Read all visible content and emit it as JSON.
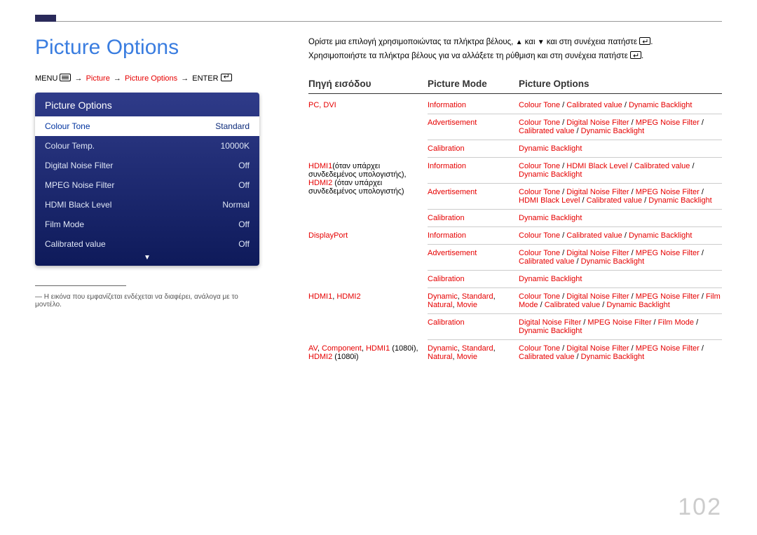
{
  "page_title": "Picture Options",
  "menupath": {
    "menu": "MENU",
    "picture": "Picture",
    "picture_options": "Picture Options",
    "enter": "ENTER"
  },
  "panel": {
    "title": "Picture Options",
    "rows": [
      {
        "label": "Colour Tone",
        "value": "Standard",
        "selected": true
      },
      {
        "label": "Colour Temp.",
        "value": "10000K"
      },
      {
        "label": "Digital Noise Filter",
        "value": "Off"
      },
      {
        "label": "MPEG Noise Filter",
        "value": "Off"
      },
      {
        "label": "HDMI Black Level",
        "value": "Normal"
      },
      {
        "label": "Film Mode",
        "value": "Off"
      },
      {
        "label": "Calibrated value",
        "value": "Off"
      }
    ]
  },
  "footnote_dash": "―",
  "footnote": "Η εικόνα που εμφανίζεται ενδέχεται να διαφέρει, ανάλογα με το μοντέλο.",
  "intro1_a": "Ορίστε μια επιλογή χρησιμοποιώντας τα πλήκτρα βέλους, ",
  "intro1_b": " και ",
  "intro1_c": " και στη συνέχεια πατήστε ",
  "intro1_d": ".",
  "intro2_a": "Χρησιμοποιήστε τα πλήκτρα βέλους για να αλλάξετε τη ρύθμιση και στη συνέχεια πατήστε ",
  "intro2_b": ".",
  "tri_up": "▲",
  "tri_down": "▼",
  "thead": {
    "c1": "Πηγή εισόδου",
    "c2": "Picture Mode",
    "c3": "Picture Options"
  },
  "blocks": [
    {
      "src": [
        {
          "t": "PC, DVI",
          "red": true
        }
      ],
      "subs": [
        {
          "mode": [
            {
              "t": "Information",
              "red": true
            }
          ],
          "opts": [
            {
              "t": "Colour Tone",
              "red": true
            },
            {
              "t": " / "
            },
            {
              "t": "Calibrated value",
              "red": true
            },
            {
              "t": " / "
            },
            {
              "t": "Dynamic Backlight",
              "red": true
            }
          ]
        },
        {
          "mode": [
            {
              "t": "Advertisement",
              "red": true
            }
          ],
          "opts": [
            {
              "t": "Colour Tone",
              "red": true
            },
            {
              "t": " / "
            },
            {
              "t": "Digital Noise Filter",
              "red": true
            },
            {
              "t": " / "
            },
            {
              "t": "MPEG Noise Filter",
              "red": true
            },
            {
              "t": " / "
            },
            {
              "t": "Calibrated value",
              "red": true
            },
            {
              "t": " / "
            },
            {
              "t": "Dynamic Backlight",
              "red": true
            }
          ]
        },
        {
          "mode": [
            {
              "t": "Calibration",
              "red": true
            }
          ],
          "opts": [
            {
              "t": "Dynamic Backlight",
              "red": true
            }
          ]
        }
      ]
    },
    {
      "src": [
        {
          "t": "HDMI1",
          "red": true
        },
        {
          "t": "(όταν υπάρχει συνδεδεμένος υπολογιστής), "
        },
        {
          "t": "HDMI2",
          "red": true
        },
        {
          "t": " (όταν υπάρχει συνδεδεμένος υπολογιστής)"
        }
      ],
      "subs": [
        {
          "mode": [
            {
              "t": "Information",
              "red": true
            }
          ],
          "opts": [
            {
              "t": "Colour Tone",
              "red": true
            },
            {
              "t": " / "
            },
            {
              "t": "HDMI Black Level",
              "red": true
            },
            {
              "t": " / "
            },
            {
              "t": "Calibrated value",
              "red": true
            },
            {
              "t": " / "
            },
            {
              "t": "Dynamic Backlight",
              "red": true
            }
          ]
        },
        {
          "mode": [
            {
              "t": "Advertisement",
              "red": true
            }
          ],
          "opts": [
            {
              "t": "Colour Tone",
              "red": true
            },
            {
              "t": " / "
            },
            {
              "t": "Digital Noise Filter",
              "red": true
            },
            {
              "t": " / "
            },
            {
              "t": "MPEG Noise Filter",
              "red": true
            },
            {
              "t": " / "
            },
            {
              "t": "HDMI Black Level",
              "red": true
            },
            {
              "t": " / "
            },
            {
              "t": "Calibrated value",
              "red": true
            },
            {
              "t": " / "
            },
            {
              "t": "Dynamic Backlight",
              "red": true
            }
          ]
        },
        {
          "mode": [
            {
              "t": "Calibration",
              "red": true
            }
          ],
          "opts": [
            {
              "t": "Dynamic Backlight",
              "red": true
            }
          ]
        }
      ]
    },
    {
      "src": [
        {
          "t": "DisplayPort",
          "red": true
        }
      ],
      "subs": [
        {
          "mode": [
            {
              "t": "Information",
              "red": true
            }
          ],
          "opts": [
            {
              "t": "Colour Tone",
              "red": true
            },
            {
              "t": " / "
            },
            {
              "t": "Calibrated value",
              "red": true
            },
            {
              "t": " / "
            },
            {
              "t": "Dynamic Backlight",
              "red": true
            }
          ]
        },
        {
          "mode": [
            {
              "t": "Advertisement",
              "red": true
            }
          ],
          "opts": [
            {
              "t": "Colour Tone",
              "red": true
            },
            {
              "t": " / "
            },
            {
              "t": "Digital Noise Filter",
              "red": true
            },
            {
              "t": " / "
            },
            {
              "t": "MPEG Noise Filter",
              "red": true
            },
            {
              "t": " / "
            },
            {
              "t": "Calibrated value",
              "red": true
            },
            {
              "t": " / "
            },
            {
              "t": "Dynamic Backlight",
              "red": true
            }
          ]
        },
        {
          "mode": [
            {
              "t": "Calibration",
              "red": true
            }
          ],
          "opts": [
            {
              "t": "Dynamic Backlight",
              "red": true
            }
          ]
        }
      ]
    },
    {
      "src": [
        {
          "t": "HDMI1",
          "red": true
        },
        {
          "t": ", "
        },
        {
          "t": "HDMI2",
          "red": true
        }
      ],
      "subs": [
        {
          "mode": [
            {
              "t": "Dynamic",
              "red": true
            },
            {
              "t": ", "
            },
            {
              "t": "Standard",
              "red": true
            },
            {
              "t": ", "
            },
            {
              "t": "Natural",
              "red": true
            },
            {
              "t": ", "
            },
            {
              "t": "Movie",
              "red": true
            }
          ],
          "opts": [
            {
              "t": "Colour Tone",
              "red": true
            },
            {
              "t": " / "
            },
            {
              "t": "Digital Noise Filter",
              "red": true
            },
            {
              "t": " / "
            },
            {
              "t": "MPEG Noise Filter",
              "red": true
            },
            {
              "t": " / "
            },
            {
              "t": "Film Mode",
              "red": true
            },
            {
              "t": " / "
            },
            {
              "t": "Calibrated value",
              "red": true
            },
            {
              "t": " / "
            },
            {
              "t": "Dynamic Backlight",
              "red": true
            }
          ]
        },
        {
          "mode": [
            {
              "t": "Calibration",
              "red": true
            }
          ],
          "opts": [
            {
              "t": "Digital Noise Filter",
              "red": true
            },
            {
              "t": " / "
            },
            {
              "t": "MPEG Noise Filter",
              "red": true
            },
            {
              "t": " / "
            },
            {
              "t": "Film Mode",
              "red": true
            },
            {
              "t": " / "
            },
            {
              "t": "Dynamic Backlight",
              "red": true
            }
          ]
        }
      ]
    },
    {
      "src": [
        {
          "t": "AV",
          "red": true
        },
        {
          "t": ", "
        },
        {
          "t": "Component",
          "red": true
        },
        {
          "t": ", "
        },
        {
          "t": "HDMI1",
          "red": true
        },
        {
          "t": " (1080i), "
        },
        {
          "t": "HDMI2",
          "red": true
        },
        {
          "t": " (1080i)"
        }
      ],
      "subs": [
        {
          "mode": [
            {
              "t": "Dynamic",
              "red": true
            },
            {
              "t": ", "
            },
            {
              "t": "Standard",
              "red": true
            },
            {
              "t": ", "
            },
            {
              "t": "Natural",
              "red": true
            },
            {
              "t": ", "
            },
            {
              "t": "Movie",
              "red": true
            }
          ],
          "opts": [
            {
              "t": "Colour Tone",
              "red": true
            },
            {
              "t": " / "
            },
            {
              "t": "Digital Noise Filter",
              "red": true
            },
            {
              "t": " / "
            },
            {
              "t": "MPEG Noise Filter",
              "red": true
            },
            {
              "t": " / "
            },
            {
              "t": "Calibrated value",
              "red": true
            },
            {
              "t": " / "
            },
            {
              "t": "Dynamic Backlight",
              "red": true
            }
          ]
        }
      ]
    }
  ],
  "page_number": "102"
}
